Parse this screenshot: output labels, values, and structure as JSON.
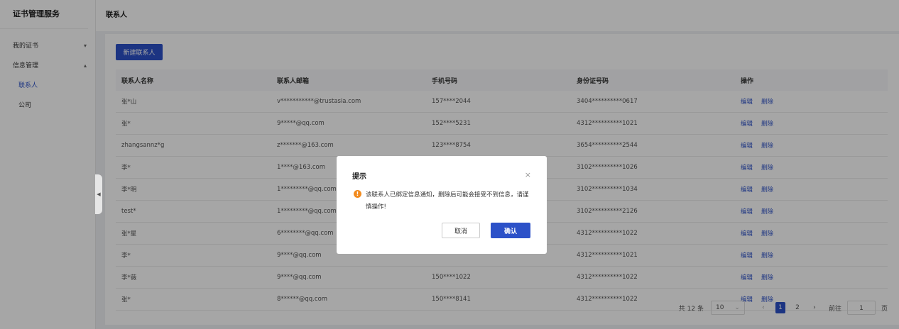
{
  "app": {
    "title": "证书管理服务"
  },
  "sidebar": {
    "items": [
      {
        "label": "我的证书",
        "chevron": "▾"
      },
      {
        "label": "信息管理",
        "chevron": "▴"
      }
    ],
    "sub_items": [
      {
        "label": "联系人"
      },
      {
        "label": "公司"
      }
    ]
  },
  "header": {
    "title": "联系人"
  },
  "toolbar": {
    "new_label": "新建联系人"
  },
  "table": {
    "columns": [
      "联系人名称",
      "联系人邮箱",
      "手机号码",
      "身份证号码",
      "操作"
    ],
    "rows": [
      {
        "name": "张*山",
        "email": "v***********@trustasia.com",
        "phone": "157****2044",
        "id": "3404**********0617"
      },
      {
        "name": "张*",
        "email": "9*****@qq.com",
        "phone": "152****5231",
        "id": "4312**********1021"
      },
      {
        "name": "zhangsannz*g",
        "email": "z*******@163.com",
        "phone": "123****8754",
        "id": "3654**********2544"
      },
      {
        "name": "李*",
        "email": "1****@163.com",
        "phone": "",
        "id": "3102**********1026"
      },
      {
        "name": "李*明",
        "email": "1*********@qq.com",
        "phone": "",
        "id": "3102**********1034"
      },
      {
        "name": "test*",
        "email": "1*********@qq.com",
        "phone": "",
        "id": "3102**********2126"
      },
      {
        "name": "张*星",
        "email": "6********@qq.com",
        "phone": "",
        "id": "4312**********1022"
      },
      {
        "name": "李*",
        "email": "9****@qq.com",
        "phone": "",
        "id": "4312**********1021"
      },
      {
        "name": "李*薇",
        "email": "9****@qq.com",
        "phone": "150****1022",
        "id": "4312**********1022"
      },
      {
        "name": "张*",
        "email": "8******@qq.com",
        "phone": "150****8141",
        "id": "4312**********1022"
      }
    ],
    "edit_label": "编辑",
    "delete_label": "删除"
  },
  "pagination": {
    "total": "共 12 条",
    "page_size": "10",
    "pages": [
      "1",
      "2"
    ],
    "current": "1",
    "goto_label": "前往",
    "goto_value": "1",
    "page_suffix": "页"
  },
  "dialog": {
    "title": "提示",
    "message": "该联系人已绑定信息通知，删除后可能会接受不到信息，请谨慎操作!",
    "cancel_label": "取消",
    "confirm_label": "确认"
  },
  "icons": {
    "close": "×",
    "warning": "!",
    "collapse": "◀",
    "prev": "‹",
    "next": "›",
    "select": "⌄"
  },
  "colors": {
    "accent": "#2c51c8",
    "warning": "#f28b1f"
  }
}
